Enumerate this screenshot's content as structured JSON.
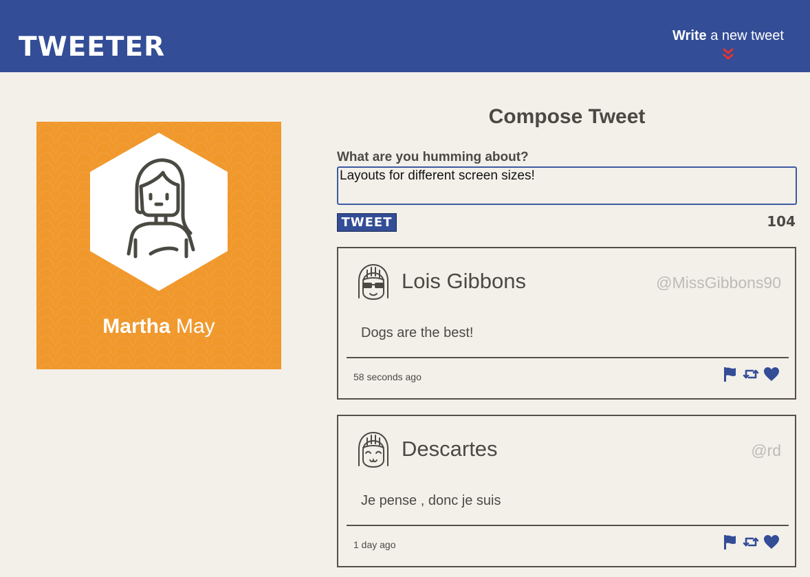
{
  "nav": {
    "brand": "TWEETER",
    "compose_toggle": {
      "bold": "Write",
      "rest": " a new tweet"
    }
  },
  "profile": {
    "first_name": "Martha",
    "last_name": "May"
  },
  "compose": {
    "title": "Compose Tweet",
    "label": "What are you humming about?",
    "value": "Layouts for different screen sizes!",
    "button": "TWEET",
    "counter": "104"
  },
  "tweets": [
    {
      "name": "Lois Gibbons",
      "handle": "@MissGibbons90",
      "text": "Dogs are the best!",
      "time": "58 seconds ago",
      "avatar_icon": "avatar-glasses-icon"
    },
    {
      "name": "Descartes",
      "handle": "@rd",
      "text": "Je pense , donc je suis",
      "time": "1 day ago",
      "avatar_icon": "avatar-smiling-icon"
    }
  ],
  "colors": {
    "nav_bg": "#334d96",
    "page_bg": "#f3f0ea",
    "profile_bg": "#f0982c",
    "accent_red": "#e8322e",
    "text": "#4a4942"
  }
}
